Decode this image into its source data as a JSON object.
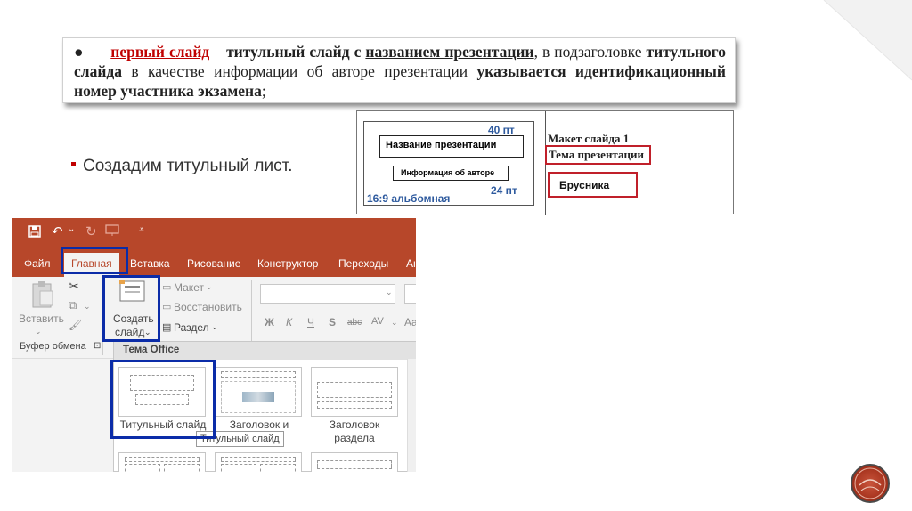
{
  "instruction": {
    "bullet": "●",
    "red_term": "первый слайд",
    "dash": " – ",
    "bold_1": "титульный слайд с",
    "underlined": "названием презентации",
    "text_1": ", в подзаголовке",
    "bold_2": "титульного слайда",
    "text_2": " в качестве информации об авторе презентации ",
    "bold_3": "указывается идентификационный номер участника экзамена",
    "text_3": ";"
  },
  "bullet_text": "Создадим титульный лист.",
  "layout_table": {
    "size_40": "40 пт",
    "title_placeholder": "Название презентации",
    "author_placeholder": "Информация об авторе",
    "size_24": "24 пт",
    "ratio": "16:9 альбомная",
    "maket": "Макет слайда 1",
    "tema": "Тема презентации",
    "brusnika": "Брусника"
  },
  "powerpoint": {
    "tabs": [
      "Файл",
      "Главная",
      "Вставка",
      "Рисование",
      "Конструктор",
      "Переходы",
      "Ан"
    ],
    "active_tab": "Главная",
    "paste_label": "Вставить",
    "new_slide_label_1": "Создать",
    "new_slide_label_2": "слайд",
    "layout_label": "Макет",
    "reset_label": "Восстановить",
    "section_label": "Раздел",
    "clipboard_group": "Буфер обмена",
    "font_buttons": [
      "Ж",
      "К",
      "Ч",
      "S",
      "abc",
      "AV",
      "Aa"
    ],
    "gallery_header": "Тема Office",
    "layouts": [
      {
        "label": "Титульный слайд"
      },
      {
        "label": "Заголовок и"
      },
      {
        "label": "Заголовок раздела"
      }
    ],
    "tooltip": "Титульный слайд",
    "colors": {
      "title_bar": "#b7472a",
      "highlight": "#0b2ca8"
    }
  }
}
